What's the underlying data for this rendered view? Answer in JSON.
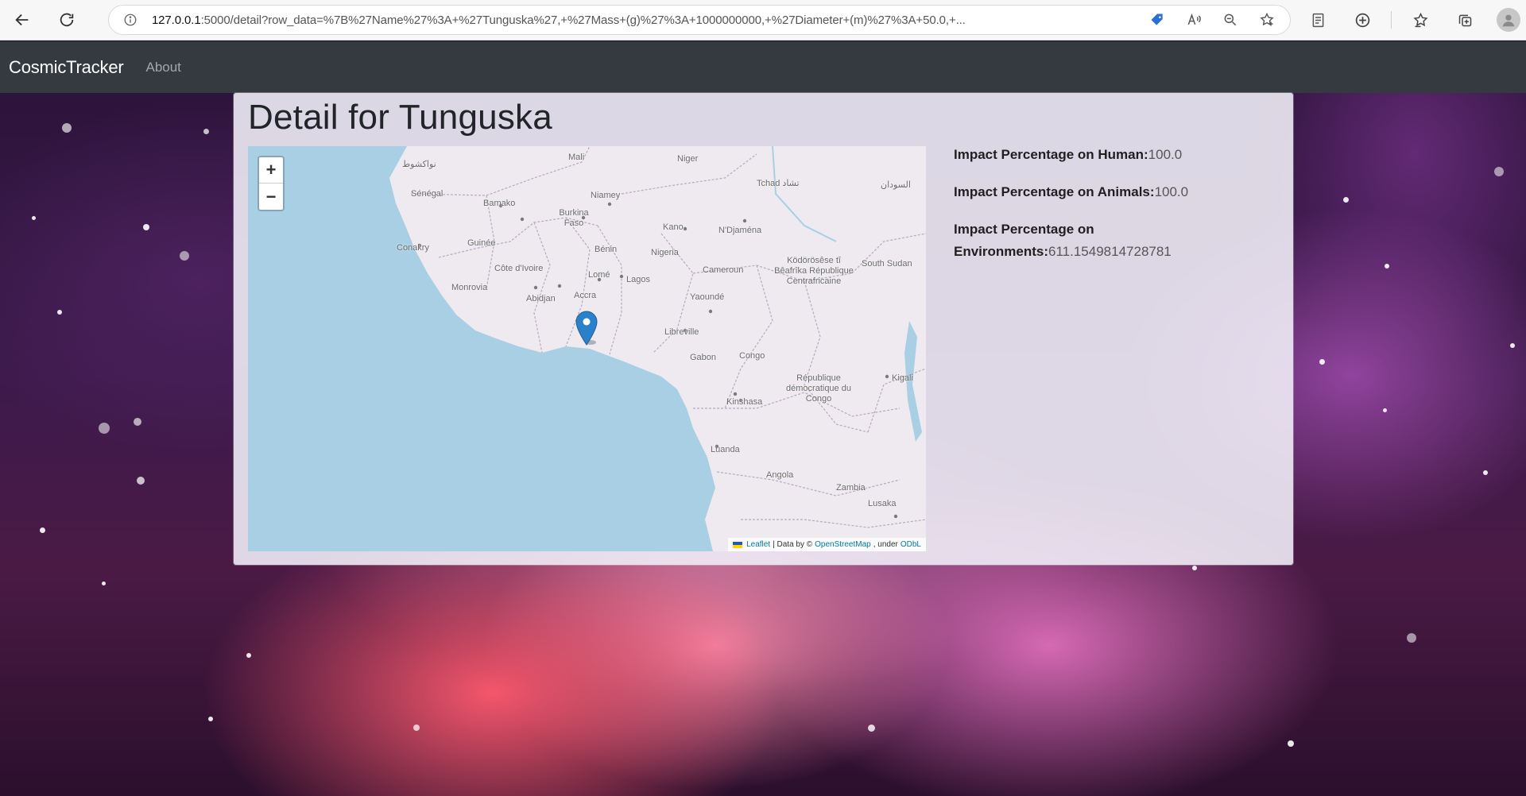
{
  "browser": {
    "url_host": "127.0.0.1",
    "url_rest": ":5000/detail?row_data=%7B%27Name%27%3A+%27Tunguska%27,+%27Mass+(g)%27%3A+1000000000,+%27Diameter+(m)%27%3A+50.0,+...",
    "icons": {
      "back": "arrow-left-icon",
      "reload": "reload-icon",
      "site_info": "info-icon",
      "extension": "tag-icon",
      "read_aloud": "read-aloud-icon",
      "zoom": "zoom-out-icon",
      "favorite": "star-add-icon",
      "reading_view": "reading-view-icon",
      "extensions": "extensions-icon",
      "favorites": "favorites-icon",
      "collections": "collections-icon",
      "profile": "profile-icon"
    }
  },
  "navbar": {
    "brand": "CosmicTracker",
    "links": [
      {
        "label": "About"
      }
    ]
  },
  "detail": {
    "title": "Detail for Tunguska",
    "impacts": [
      {
        "label": "Impact Percentage on Human:",
        "value": "100.0"
      },
      {
        "label": "Impact Percentage on Animals:",
        "value": "100.0"
      },
      {
        "label": "Impact Percentage on Environments:",
        "value": "611.1549814728781"
      }
    ]
  },
  "map": {
    "zoom_in": "+",
    "zoom_out": "−",
    "attribution": {
      "leaflet": "Leaflet",
      "sep": "| Data by ©",
      "osm": "OpenStreetMap",
      "under": ", under",
      "odbl": "ODbL"
    },
    "labels": [
      "Mali",
      "Niger",
      "Tchad تشاد",
      "السودان",
      "Sénégal",
      "Bamako",
      "Niamey",
      "Burkina Faso",
      "Kano",
      "N'Djaména",
      "Guinée",
      "Conakry",
      "Bénin",
      "Nigeria",
      "Côte d'Ivoire",
      "Lomé",
      "Lagos",
      "Cameroun",
      "Ködörösêse tî Bêafrîka République Centrafricaine",
      "South Sudan",
      "Monrovia",
      "Abidjan",
      "Accra",
      "Yaoundé",
      "Libreville",
      "Gabon",
      "Congo",
      "République démocratique du Congo",
      "Kigali",
      "Kinshasa",
      "Luanda",
      "Angola",
      "Zambia",
      "Lusaka",
      "نواكشوط"
    ],
    "colors": {
      "ocean": "#a9cfe4",
      "land": "#eeeaf0",
      "border": "#b9a9c0",
      "marker": "#2a81cb"
    }
  }
}
